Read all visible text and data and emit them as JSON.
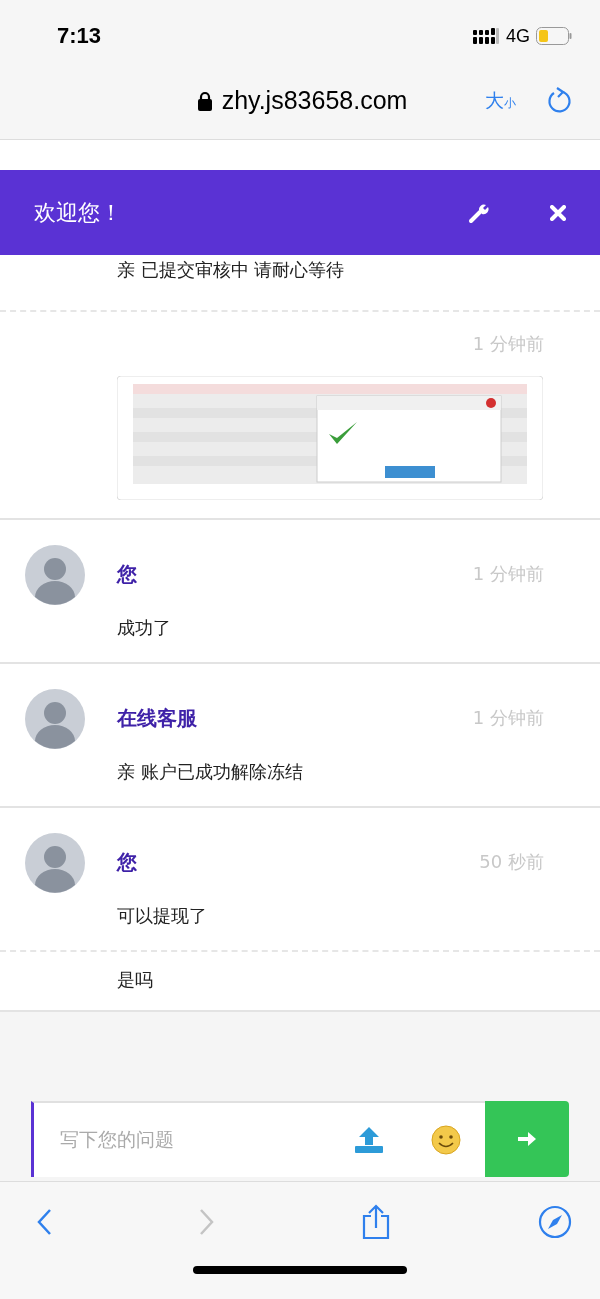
{
  "status_bar": {
    "time": "7:13",
    "network": "4G"
  },
  "browser": {
    "url": "zhy.js83658.com",
    "text_size": {
      "large": "大",
      "small": "小"
    }
  },
  "header": {
    "title": "欢迎您！"
  },
  "messages": [
    {
      "kind": "continuation",
      "text": "亲 已提交审核中 请耐心等待",
      "dashed_divider": true
    },
    {
      "kind": "continuation",
      "time": "1 分钟前",
      "dashed_divider": false
    },
    {
      "kind": "full",
      "sender": "您",
      "time": "1 分钟前",
      "text": "成功了",
      "dashed_divider": false
    },
    {
      "kind": "full",
      "sender": "在线客服",
      "time": "1 分钟前",
      "text": "亲 账户已成功解除冻结",
      "dashed_divider": false
    },
    {
      "kind": "full",
      "sender": "您",
      "time": "50 秒前",
      "text": "可以提现了",
      "dashed_divider": true
    },
    {
      "kind": "continuation",
      "text": "是吗",
      "dashed_divider": false
    }
  ],
  "composer": {
    "placeholder": "写下您的问题"
  },
  "toolbar": {
    "back": {
      "disabled": false
    },
    "forward": {
      "disabled": true
    }
  }
}
